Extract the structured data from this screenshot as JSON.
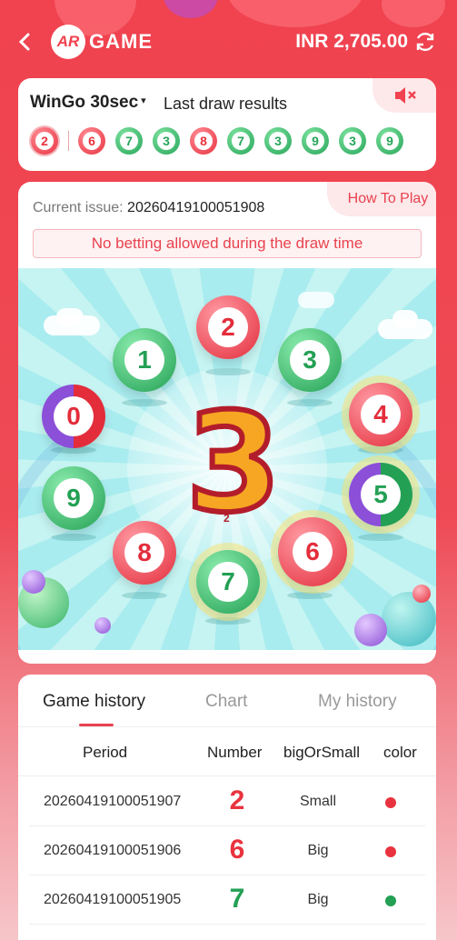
{
  "header": {
    "back_icon": "chevron-left-icon",
    "logo_mark": "AR",
    "logo_text": "GAME",
    "balance": "INR 2,705.00",
    "refresh_icon": "refresh-icon"
  },
  "results": {
    "game_name": "WinGo 30sec",
    "caret": "▾",
    "label": "Last draw results",
    "sound_icon": "mute-speaker-icon",
    "recent": [
      {
        "n": "2",
        "color": "red"
      },
      {
        "n": "6",
        "color": "red"
      },
      {
        "n": "7",
        "color": "green"
      },
      {
        "n": "3",
        "color": "green"
      },
      {
        "n": "8",
        "color": "red"
      },
      {
        "n": "7",
        "color": "green"
      },
      {
        "n": "3",
        "color": "green"
      },
      {
        "n": "9",
        "color": "green"
      },
      {
        "n": "3",
        "color": "green"
      },
      {
        "n": "9",
        "color": "green"
      }
    ]
  },
  "game": {
    "issue_label": "Current issue:",
    "issue_number": "20260419100051908",
    "how_to_play": "How To Play",
    "notice": "No betting allowed during the draw time",
    "balls": [
      "0",
      "1",
      "2",
      "3",
      "4",
      "5",
      "6",
      "7",
      "8",
      "9"
    ],
    "result": "3",
    "result_sub": "2"
  },
  "history": {
    "tabs": [
      "Game history",
      "Chart",
      "My history"
    ],
    "columns": [
      "Period",
      "Number",
      "bigOrSmall",
      "color"
    ],
    "rows": [
      {
        "period": "20260419100051907",
        "number": "2",
        "size": "Small",
        "color": "#e8333f"
      },
      {
        "period": "20260419100051906",
        "number": "6",
        "size": "Big",
        "color": "#e8333f"
      },
      {
        "period": "20260419100051905",
        "number": "7",
        "size": "Big",
        "color": "#23a054"
      }
    ]
  }
}
